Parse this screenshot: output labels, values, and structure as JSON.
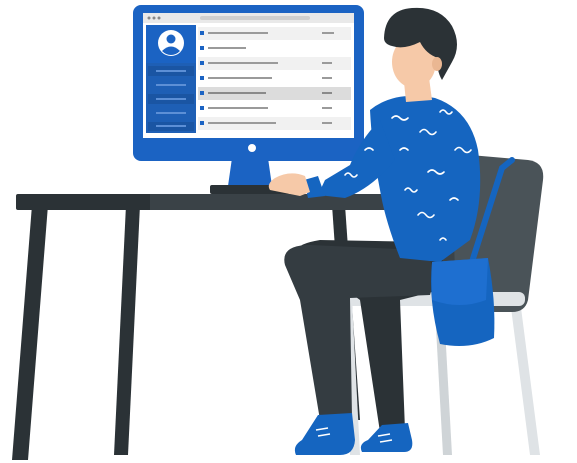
{
  "colors": {
    "accent_blue": "#1565c0",
    "monitor_blue": "#1b63c3",
    "dark": "#2b3236",
    "chair_grey": "#4a5358",
    "skin": "#f6c9a8",
    "white": "#ffffff",
    "screen_row_light": "#f1f1f1",
    "screen_row_dark": "#dcdcdc",
    "screen_text_line": "#9a9a9a",
    "sidebar_highlight": "#1e5fb5"
  },
  "illustration": {
    "subject": "person-working-at-desktop-computer",
    "icons": [
      "user-avatar-icon"
    ]
  },
  "screen": {
    "sidebar_rows": 5,
    "list_rows": 7
  }
}
